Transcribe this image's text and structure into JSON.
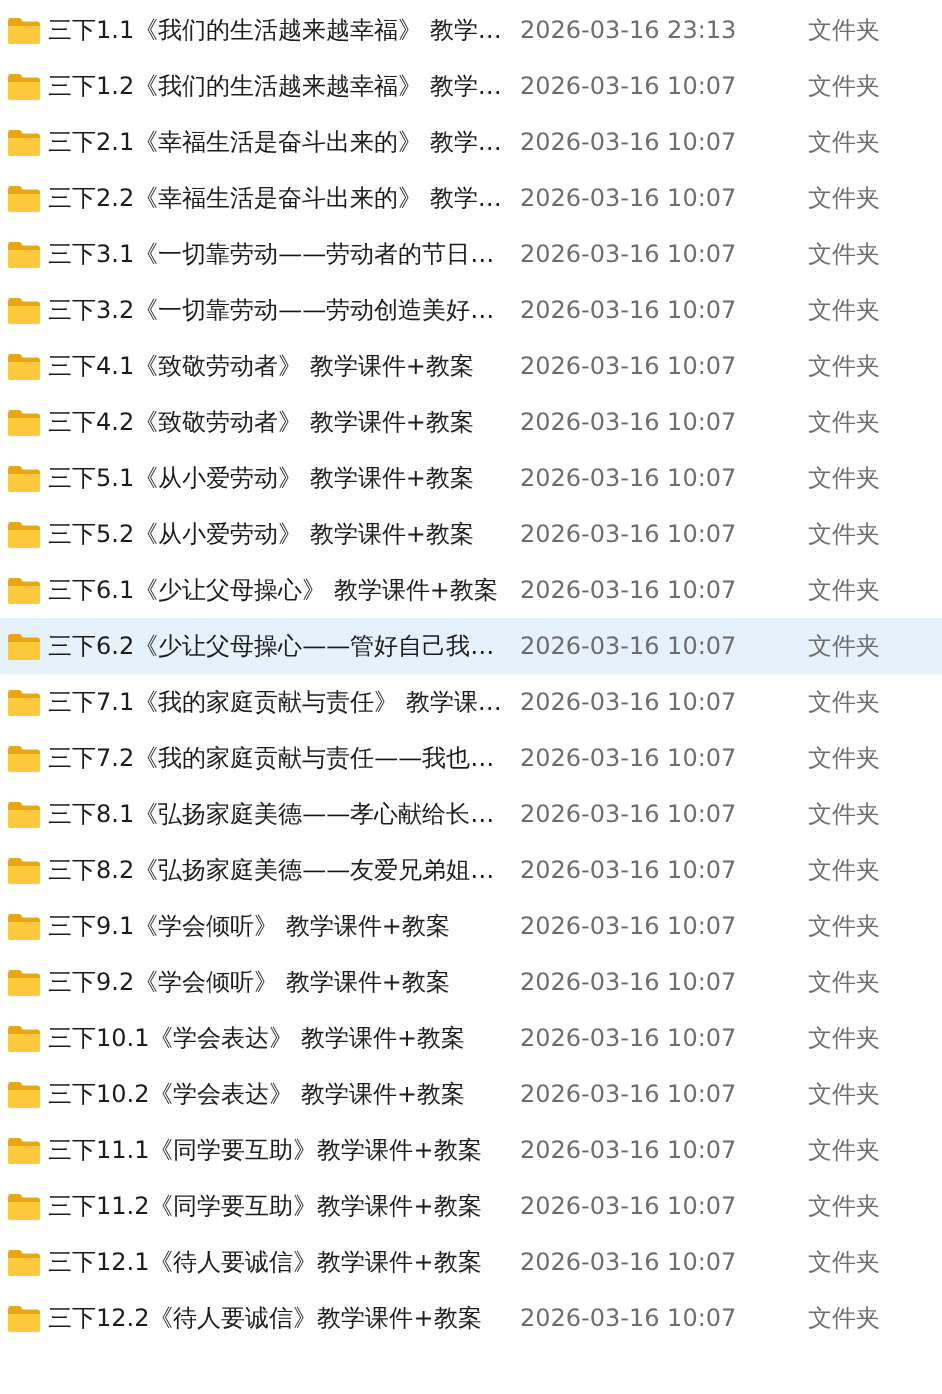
{
  "files": [
    {
      "name": "三下1.1《我们的生活越来越幸福》 教学…",
      "modified": "2026-03-16 23:13",
      "type": "文件夹",
      "selected": false
    },
    {
      "name": "三下1.2《我们的生活越来越幸福》 教学…",
      "modified": "2026-03-16 10:07",
      "type": "文件夹",
      "selected": false
    },
    {
      "name": "三下2.1《幸福生活是奋斗出来的》 教学…",
      "modified": "2026-03-16 10:07",
      "type": "文件夹",
      "selected": false
    },
    {
      "name": "三下2.2《幸福生活是奋斗出来的》 教学…",
      "modified": "2026-03-16 10:07",
      "type": "文件夹",
      "selected": false
    },
    {
      "name": "三下3.1《一切靠劳动——劳动者的节日…",
      "modified": "2026-03-16 10:07",
      "type": "文件夹",
      "selected": false
    },
    {
      "name": "三下3.2《一切靠劳动——劳动创造美好…",
      "modified": "2026-03-16 10:07",
      "type": "文件夹",
      "selected": false
    },
    {
      "name": "三下4.1《致敬劳动者》 教学课件+教案",
      "modified": "2026-03-16 10:07",
      "type": "文件夹",
      "selected": false
    },
    {
      "name": "三下4.2《致敬劳动者》 教学课件+教案",
      "modified": "2026-03-16 10:07",
      "type": "文件夹",
      "selected": false
    },
    {
      "name": "三下5.1《从小爱劳动》 教学课件+教案",
      "modified": "2026-03-16 10:07",
      "type": "文件夹",
      "selected": false
    },
    {
      "name": "三下5.2《从小爱劳动》 教学课件+教案",
      "modified": "2026-03-16 10:07",
      "type": "文件夹",
      "selected": false
    },
    {
      "name": "三下6.1《少让父母操心》 教学课件+教案",
      "modified": "2026-03-16 10:07",
      "type": "文件夹",
      "selected": false
    },
    {
      "name": "三下6.2《少让父母操心——管好自己我…",
      "modified": "2026-03-16 10:07",
      "type": "文件夹",
      "selected": true
    },
    {
      "name": "三下7.1《我的家庭贡献与责任》 教学课…",
      "modified": "2026-03-16 10:07",
      "type": "文件夹",
      "selected": false
    },
    {
      "name": "三下7.2《我的家庭贡献与责任——我也…",
      "modified": "2026-03-16 10:07",
      "type": "文件夹",
      "selected": false
    },
    {
      "name": "三下8.1《弘扬家庭美德——孝心献给长…",
      "modified": "2026-03-16 10:07",
      "type": "文件夹",
      "selected": false
    },
    {
      "name": "三下8.2《弘扬家庭美德——友爱兄弟姐…",
      "modified": "2026-03-16 10:07",
      "type": "文件夹",
      "selected": false
    },
    {
      "name": "三下9.1《学会倾听》 教学课件+教案",
      "modified": "2026-03-16 10:07",
      "type": "文件夹",
      "selected": false
    },
    {
      "name": "三下9.2《学会倾听》 教学课件+教案",
      "modified": "2026-03-16 10:07",
      "type": "文件夹",
      "selected": false
    },
    {
      "name": "三下10.1《学会表达》 教学课件+教案",
      "modified": "2026-03-16 10:07",
      "type": "文件夹",
      "selected": false
    },
    {
      "name": "三下10.2《学会表达》 教学课件+教案",
      "modified": "2026-03-16 10:07",
      "type": "文件夹",
      "selected": false
    },
    {
      "name": "三下11.1《同学要互助》教学课件+教案",
      "modified": "2026-03-16 10:07",
      "type": "文件夹",
      "selected": false
    },
    {
      "name": "三下11.2《同学要互助》教学课件+教案",
      "modified": "2026-03-16 10:07",
      "type": "文件夹",
      "selected": false
    },
    {
      "name": "三下12.1《待人要诚信》教学课件+教案",
      "modified": "2026-03-16 10:07",
      "type": "文件夹",
      "selected": false
    },
    {
      "name": "三下12.2《待人要诚信》教学课件+教案",
      "modified": "2026-03-16 10:07",
      "type": "文件夹",
      "selected": false
    }
  ]
}
